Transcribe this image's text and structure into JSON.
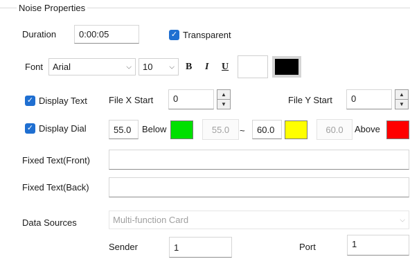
{
  "group": {
    "title": "Noise Properties"
  },
  "duration": {
    "label": "Duration",
    "value": "0:00:05"
  },
  "transparent": {
    "label": "Transparent",
    "checked": true
  },
  "font": {
    "label": "Font",
    "family": "Arial",
    "size": "10",
    "bold_glyph": "B",
    "italic_glyph": "I",
    "underline_glyph": "U",
    "bg_color": "#ffffff",
    "text_color": "#000000"
  },
  "display_text": {
    "label": "Display Text",
    "checked": true
  },
  "file_x_start": {
    "label": "File X Start",
    "value": "0"
  },
  "file_y_start": {
    "label": "File Y Start",
    "value": "0"
  },
  "display_dial": {
    "label": "Display Dial",
    "checked": true,
    "below_value": "55.0",
    "below_label": "Below",
    "below_color": "#00e000",
    "below_readonly": "55.0",
    "tilde": "~",
    "above_value": "60.0",
    "mid_color": "#ffff00",
    "above_readonly": "60.0",
    "above_label": "Above",
    "above_color": "#ff0000"
  },
  "fixed_text_front": {
    "label": "Fixed Text(Front)",
    "value": ""
  },
  "fixed_text_back": {
    "label": "Fixed Text(Back)",
    "value": ""
  },
  "data_sources": {
    "label": "Data Sources",
    "value": "Multi-function Card"
  },
  "sender": {
    "label": "Sender",
    "value": "1"
  },
  "port": {
    "label": "Port",
    "value": "1"
  },
  "icons": {
    "check": "✓",
    "caret_down": "⌵",
    "spin_up": "▲",
    "spin_down": "▼"
  }
}
